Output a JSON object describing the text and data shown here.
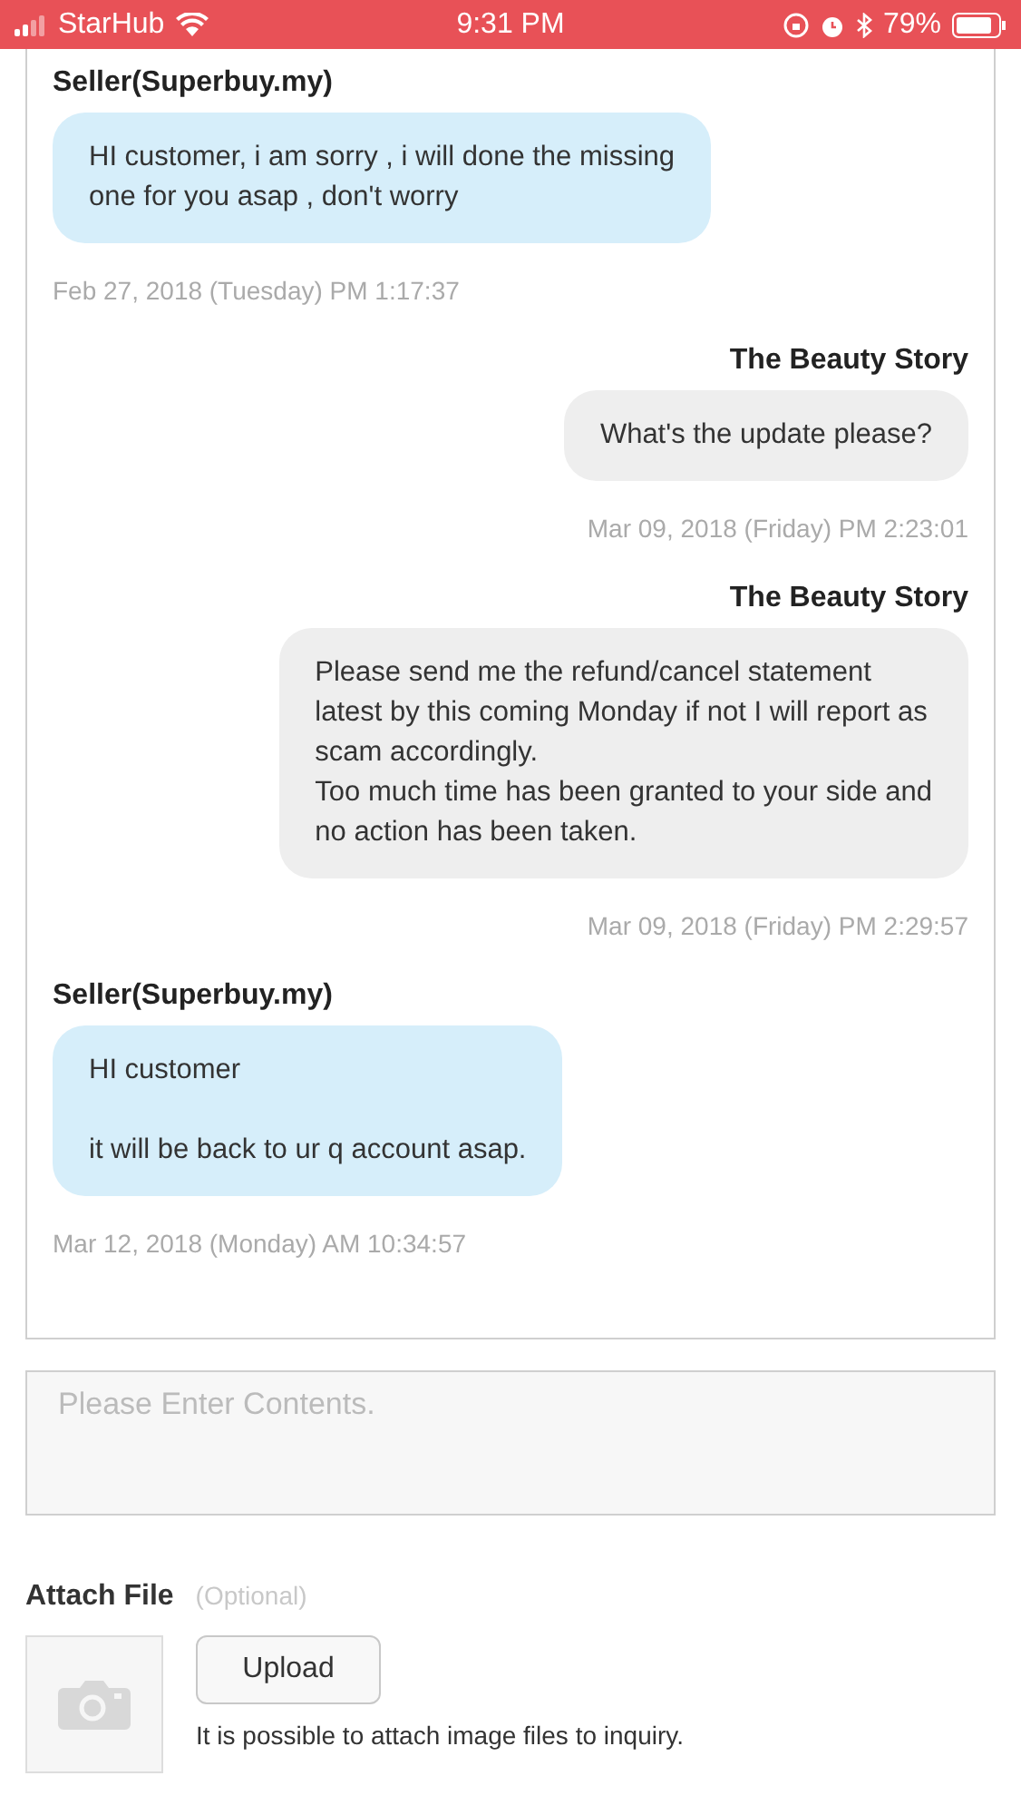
{
  "status_bar": {
    "carrier": "StarHub",
    "time": "9:31 PM",
    "battery": "79%"
  },
  "messages": [
    {
      "kind": "seller",
      "sender": "Seller(Superbuy.my)",
      "text": "HI customer, i am sorry , i will done the missing\none for you asap , don't worry",
      "time": "Feb 27, 2018 (Tuesday) PM 1:17:37"
    },
    {
      "kind": "buyer",
      "sender": "The Beauty Story",
      "text": "What's the update please?",
      "time": "Mar 09, 2018 (Friday) PM 2:23:01"
    },
    {
      "kind": "buyer",
      "sender": "The Beauty Story",
      "text": "Please send me the refund/cancel statement\nlatest by this coming Monday if not I will report as\nscam accordingly.\nToo much time has been granted to your side and\nno action has been taken.",
      "time": "Mar 09, 2018 (Friday) PM 2:29:57"
    },
    {
      "kind": "seller",
      "sender": "Seller(Superbuy.my)",
      "text": "HI customer\n\nit will be back to ur q account asap.",
      "time": "Mar 12, 2018 (Monday) AM 10:34:57"
    }
  ],
  "contents": {
    "placeholder": "Please Enter Contents."
  },
  "attach": {
    "title": "Attach File",
    "optional": "(Optional)",
    "button": "Upload",
    "hint": "It is possible to attach image files to inquiry."
  }
}
